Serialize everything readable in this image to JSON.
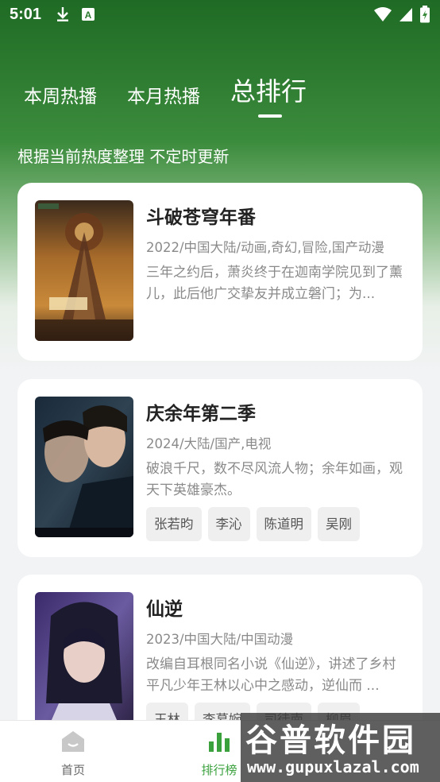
{
  "status_bar": {
    "time": "5:01",
    "left_icons": [
      "download-icon",
      "keyboard-icon"
    ],
    "right_icons": [
      "wifi-icon",
      "signal-icon",
      "battery-icon"
    ]
  },
  "tabs": [
    {
      "label": "本周热播",
      "active": false
    },
    {
      "label": "本月热播",
      "active": false
    },
    {
      "label": "总排行",
      "active": true
    }
  ],
  "subtitle": "根据当前热度整理 不定时更新",
  "cards": [
    {
      "title": "斗破苍穹年番",
      "meta": "2022/中国大陆/动画,奇幻,冒险,国产动漫",
      "desc": "三年之约后，萧炎终于在迦南学院见到了薰儿，此后他广交挚友并成立磐门；为...",
      "tags": []
    },
    {
      "title": "庆余年第二季",
      "meta": "2024/大陆/国产,电视",
      "desc": "破浪千尺，数不尽风流人物；余年如画，观天下英雄豪杰。",
      "tags": [
        "张若昀",
        "李沁",
        "陈道明",
        "吴刚"
      ]
    },
    {
      "title": "仙逆",
      "meta": "2023/中国大陆/中国动漫",
      "desc": "改编自耳根同名小说《仙逆》，讲述了乡村平凡少年王林以心中之感动，逆仙而 ...",
      "tags": [
        "王林",
        "李慕婉",
        "司徒南",
        "柳眉"
      ]
    }
  ],
  "bottom_nav": [
    {
      "label": "首页",
      "icon": "home-icon",
      "active": false
    },
    {
      "label": "排行榜",
      "icon": "ranking-icon",
      "active": true
    }
  ],
  "watermark": {
    "main": "谷普软件园",
    "url": "www.gupuxlazal.com"
  },
  "colors": {
    "accent": "#3aa13d",
    "header_green": "#2f7d32"
  }
}
